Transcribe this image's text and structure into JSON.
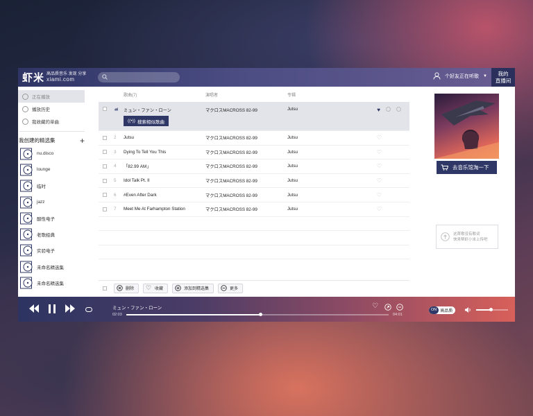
{
  "header": {
    "logo_main": "虾米",
    "logo_tagline": "高品质音乐 发现 分享",
    "logo_domain": "xiami.com",
    "search_placeholder": "",
    "friends_label": "个好友正在听歌",
    "live_label_1": "我的",
    "live_label_2": "直播间"
  },
  "sidebar": {
    "nav": [
      {
        "label": "正在播放",
        "active": true
      },
      {
        "label": "播放历史",
        "active": false
      },
      {
        "label": "我收藏的单曲",
        "active": false
      }
    ],
    "my_collections_title": "我创建的精选集",
    "collections": [
      "nu.disco",
      "lounge",
      "临时",
      "jazz",
      "酸性电子",
      "老歌经典",
      "实验电子",
      "未命名精选集",
      "未命名精选集"
    ]
  },
  "tracklist": {
    "headers": {
      "title": "歌曲(7)",
      "artist": "演唱者",
      "album": "专辑"
    },
    "similar_button": "搜索相似歌曲",
    "rows": [
      {
        "num": "",
        "title": "ミュン・ファン・ローン",
        "artist": "マクロスMACROSS 82-99",
        "album": "Jutsu",
        "playing": true
      },
      {
        "num": "2",
        "title": "Jutsu",
        "artist": "マクロスMACROSS 82-99",
        "album": "Jutsu"
      },
      {
        "num": "3",
        "title": "Dying To Tell You This",
        "artist": "マクロスMACROSS 82-99",
        "album": "Jutsu"
      },
      {
        "num": "4",
        "title": "「82.99 AM」",
        "artist": "マクロスMACROSS 82-99",
        "album": "Jutsu"
      },
      {
        "num": "5",
        "title": "Idol Talk Pt. II",
        "artist": "マクロスMACROSS 82-99",
        "album": "Jutsu"
      },
      {
        "num": "6",
        "title": "#Even After Dark",
        "artist": "マクロスMACROSS 82-99",
        "album": "Jutsu"
      },
      {
        "num": "7",
        "title": "Meet Me At Farhampton Station",
        "artist": "マクロスMACROSS 82-99",
        "album": "Jutsu"
      }
    ]
  },
  "actions": {
    "delete": "删除",
    "collect": "收藏",
    "add_to_collection": "添加到精选集",
    "more": "更多"
  },
  "right_panel": {
    "music_hall_button": "去音乐馆淘一下",
    "lyric_line_1": "这首歌没有歌词",
    "lyric_line_2": "快来帮虾小米上传吧"
  },
  "player": {
    "song": "ミュン・ファン・ローン",
    "time_current": "02:03",
    "time_total": "04:01",
    "progress": 0.51,
    "volume": 0.45,
    "quality_on": "ON",
    "quality_label": "高品质"
  },
  "colors": {
    "brand_navy": "#2f3766",
    "player_end": "#d8605a"
  }
}
